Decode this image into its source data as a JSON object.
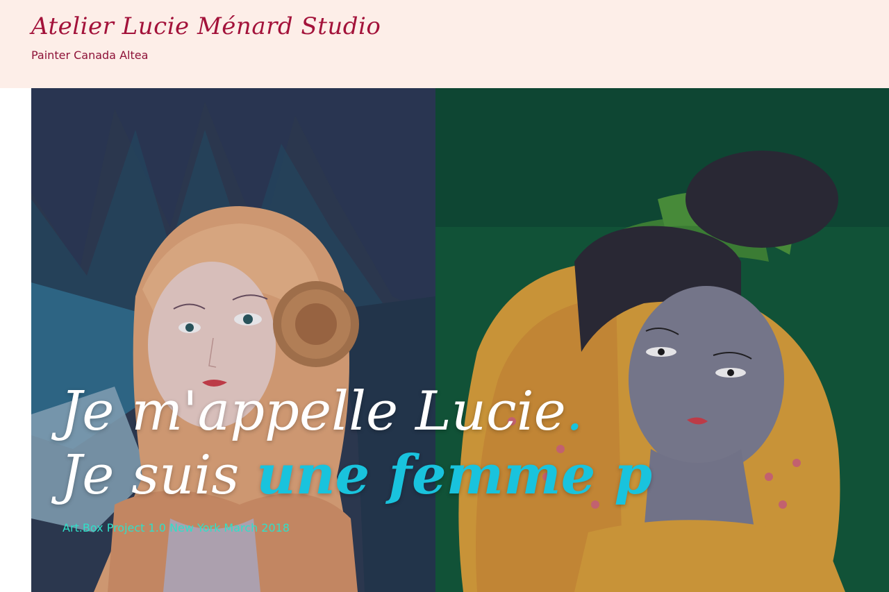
{
  "site": {
    "title": "Atelier Lucie Ménard Studio",
    "tagline": "Painter Canada Altea"
  },
  "hero": {
    "line1": "Je m'appelle Lucie",
    "line1_dot": ".",
    "line2_prefix": "Je suis ",
    "line2_typed": "une femme p",
    "subtitle": "Art.Box Project 1.0 New York March 2018"
  },
  "colors": {
    "header_bg": "#fdeee8",
    "title_color": "#a3123a",
    "accent_cyan": "#19c3dd",
    "subtitle_color": "#2fe0c8"
  }
}
